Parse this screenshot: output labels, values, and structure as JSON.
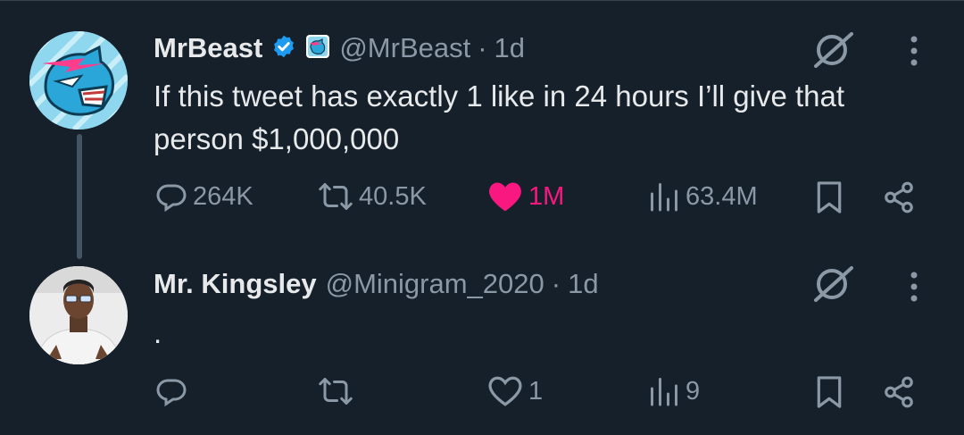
{
  "tweet": {
    "name": "MrBeast",
    "handle": "@MrBeast",
    "separator": "·",
    "time": "1d",
    "text": "If this tweet has exactly 1 like in 24 hours I’ll give that person $1,000,000",
    "replies": "264K",
    "retweets": "40.5K",
    "likes": "1M",
    "views": "63.4M",
    "liked": true
  },
  "reply": {
    "name": "Mr. Kingsley",
    "handle": "@Minigram_2020",
    "separator": "·",
    "time": "1d",
    "text": ".",
    "replies": "",
    "retweets": "",
    "likes": "1",
    "views": "9"
  },
  "colors": {
    "background": "#15202b",
    "muted": "#8b98a5",
    "like": "#f91880",
    "verified": "#1d9bf0"
  }
}
